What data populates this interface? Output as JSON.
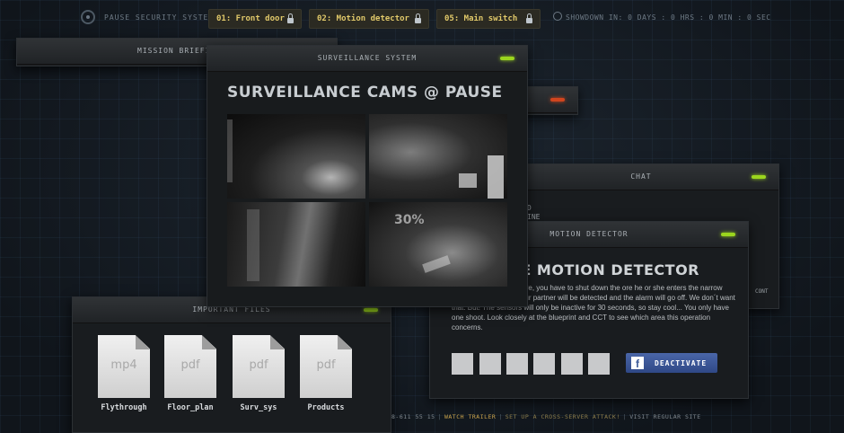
{
  "header": {
    "system_title": "PAUSE SECURITY SYSTEM",
    "locks": [
      "01: Front door",
      "02: Motion detector",
      "05: Main switch"
    ],
    "countdown": "SHOWDOWN IN: 0 DAYS : 0 HRS : 0 MIN : 0 SEC"
  },
  "windows": {
    "mission": {
      "title": "MISSION BRIEFI"
    },
    "surveillance": {
      "title": "SURVEILLANCE SYSTEM",
      "heading": "SURVEILLANCE CAMS @ PAUSE",
      "cam4_label": "30%"
    },
    "chat": {
      "title": "CHAT",
      "line1": "D",
      "line2": "INE",
      "line3": "CONT"
    },
    "files": {
      "title": "IMPORTANT FILES",
      "items": [
        {
          "ext": "mp4",
          "name": "Flythrough"
        },
        {
          "ext": "pdf",
          "name": "Floor_plan"
        },
        {
          "ext": "pdf",
          "name": "Surv_sys"
        },
        {
          "ext": "pdf",
          "name": "Products"
        }
      ]
    },
    "motion": {
      "title": "MOTION DETECTOR",
      "heading": "TE MOTION DETECTOR",
      "body": "partner is inside the store, you have to shut down the ore he or she enters the narrow passage. Otherwise your partner will be detected and the alarm will go off. We don´t want that. But! The sensors will only be inactive for 30 seconds, so stay cool... You only have one shoot. Look closely at the blueprint and CCT to see which area this operation concerns.",
      "button": "DEACTIVATE",
      "button_icon": "f"
    }
  },
  "footer": {
    "phone": "8-611 55 15",
    "links": [
      "WATCH TRAILER",
      "SET UP A CROSS-SERVER ATTACK!",
      "VISIT REGULAR SITE"
    ]
  },
  "colors": {
    "pip_green": "#9bd51e",
    "pip_red": "#d0451e",
    "lock_text": "#e1c96a",
    "facebook": "#3b5998"
  }
}
